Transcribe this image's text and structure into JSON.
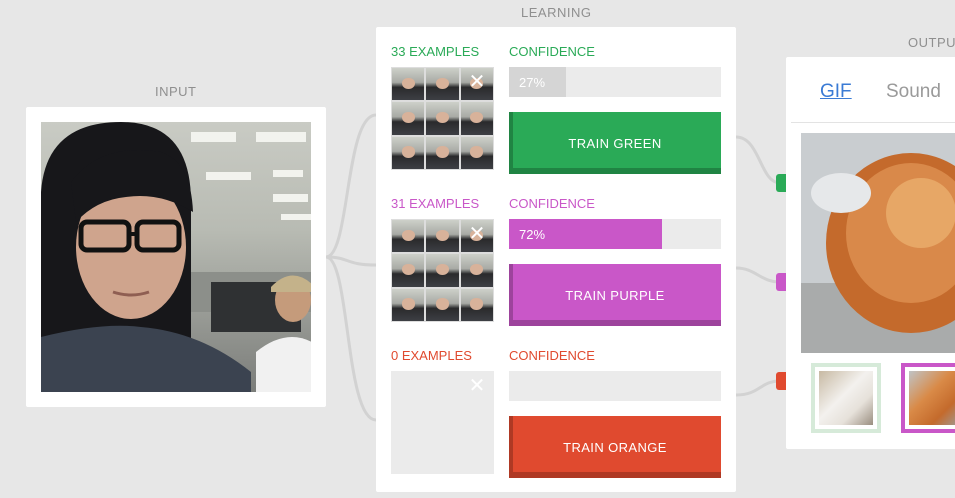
{
  "sections": {
    "input_title": "INPUT",
    "learning_title": "LEARNING",
    "output_title": "OUTPU"
  },
  "colors": {
    "green": "#2aaa57",
    "purple": "#c957c8",
    "orange": "#e04a2f",
    "wire": "#d2d2d2"
  },
  "classes": [
    {
      "examples_label": "33 EXAMPLES",
      "confidence_label": "CONFIDENCE",
      "confidence_value": "27%",
      "confidence_fraction": 0.27,
      "train_label": "TRAIN GREEN",
      "close_glyph": "✕",
      "color": "#2aaa57",
      "label_color": "#2aaa57",
      "fill_color": "#d5d5d5"
    },
    {
      "examples_label": "31 EXAMPLES",
      "confidence_label": "CONFIDENCE",
      "confidence_value": "72%",
      "confidence_fraction": 0.72,
      "train_label": "TRAIN PURPLE",
      "close_glyph": "✕",
      "color": "#c957c8",
      "label_color": "#c957c8",
      "fill_color": "#c957c8"
    },
    {
      "examples_label": "0 EXAMPLES",
      "confidence_label": "CONFIDENCE",
      "confidence_value": "",
      "confidence_fraction": 0,
      "train_label": "TRAIN ORANGE",
      "close_glyph": "✕",
      "color": "#e04a2f",
      "label_color": "#e04a2f",
      "fill_color": "#e04a2f"
    }
  ],
  "output": {
    "tabs": [
      {
        "label": "GIF",
        "active": true
      },
      {
        "label": "Sound",
        "active": false
      }
    ],
    "thumbs": [
      {
        "name": "white-dog-gif",
        "border_color": "#d6ead9"
      },
      {
        "name": "pomeranian-gif",
        "border_color": "#c957c8"
      }
    ]
  }
}
